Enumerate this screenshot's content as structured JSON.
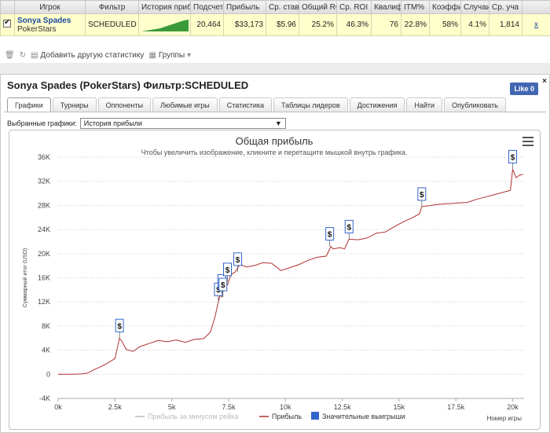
{
  "table": {
    "headers": [
      "",
      "Игрок",
      "Фильтр",
      "История прибыл",
      "Подсчет",
      "Прибыль",
      "Ср. ставк",
      "Общий ROI",
      "Ср. ROI",
      "Квалиф",
      "ITM%",
      "Коэффи",
      "Случаи",
      "Ср. уча",
      ""
    ],
    "row": {
      "player_name": "Sonya Spades",
      "player_site": "PokerStars",
      "filter": "SCHEDULED",
      "count": "20,464",
      "profit": "$33,173",
      "avg_stake": "$5.96",
      "total_roi": "25.2%",
      "avg_roi": "46.3%",
      "qualif": "76",
      "itm": "22.8%",
      "coeff": "58%",
      "cases": "4.1%",
      "avg_field": "1,814",
      "extra": "x"
    }
  },
  "toolbar": {
    "add_stat_label": "Добавить другую статистику",
    "groups_label": "Группы"
  },
  "panel": {
    "title": "Sonya Spades (PokerStars) Фильтр:SCHEDULED",
    "like_label": "Like 0",
    "close_label": "×",
    "tabs": [
      "Графики",
      "Турниры",
      "Оппоненты",
      "Любимые игры",
      "Статистика",
      "Таблицы лидеров",
      "Достижения",
      "Найти",
      "Опубликовать"
    ],
    "active_tab": 0,
    "selector_label": "Выбранные графики:",
    "selector_value": "История прибыли"
  },
  "colors": {
    "profit_line": "#b03030",
    "rake_line": "#bbbbbb",
    "big_wins": "#3366cc",
    "sparkline": "#3a9a3a"
  },
  "chart_data": {
    "type": "line",
    "title": "Общая прибыль",
    "subtitle": "Чтобы увеличить изображение, кликните и перетащите мышкой внутрь графика.",
    "xlabel": "Номер игры",
    "ylabel": "Суммарный итог (USD)",
    "xlim": [
      0,
      20500
    ],
    "ylim": [
      -4000,
      36000
    ],
    "x_ticks": [
      0,
      2500,
      5000,
      7500,
      10000,
      12500,
      15000,
      17500,
      20000
    ],
    "x_tick_labels": [
      "0k",
      "2.5k",
      "5k",
      "7.5k",
      "10k",
      "12.5k",
      "15k",
      "17.5k",
      "20k"
    ],
    "y_ticks": [
      -4000,
      0,
      4000,
      8000,
      12000,
      16000,
      20000,
      24000,
      28000,
      32000,
      36000
    ],
    "y_tick_labels": [
      "-4K",
      "0",
      "4K",
      "8K",
      "12K",
      "16K",
      "20K",
      "24K",
      "28K",
      "32K",
      "36K"
    ],
    "grid": "horizontal-dotted",
    "legend_position": "bottom",
    "series": [
      {
        "name": "Прибыль за минусом рейка",
        "values": []
      },
      {
        "name": "Прибыль",
        "x": [
          0,
          600,
          1000,
          1300,
          1600,
          1900,
          2200,
          2500,
          2700,
          2800,
          3000,
          3300,
          3600,
          4000,
          4400,
          4800,
          5200,
          5600,
          6000,
          6400,
          6700,
          6900,
          7050,
          7150,
          7200,
          7250,
          7350,
          7450,
          7600,
          7800,
          8000,
          8300,
          8700,
          9000,
          9400,
          9800,
          10200,
          10600,
          11000,
          11400,
          11800,
          12000,
          12100,
          12400,
          12600,
          12800,
          13200,
          13600,
          14000,
          14400,
          14800,
          15200,
          15600,
          15900,
          16000,
          16400,
          16800,
          17200,
          17600,
          18000,
          18400,
          18800,
          19200,
          19600,
          19900,
          20000,
          20150,
          20300,
          20450
        ],
        "values": [
          0,
          0,
          50,
          200,
          800,
          1300,
          1900,
          2600,
          6000,
          5500,
          4100,
          3800,
          4600,
          5100,
          5600,
          5400,
          5700,
          5300,
          5800,
          5900,
          7000,
          9500,
          12000,
          13400,
          12800,
          13800,
          15300,
          14800,
          16500,
          17000,
          18200,
          17800,
          18100,
          18500,
          18400,
          17200,
          17700,
          18200,
          18900,
          19400,
          19600,
          21200,
          20800,
          21000,
          20800,
          22400,
          22300,
          22600,
          23400,
          23600,
          24500,
          25300,
          26000,
          26600,
          27800,
          28000,
          28200,
          28300,
          28400,
          28500,
          29000,
          29400,
          29800,
          30200,
          30500,
          34000,
          32600,
          33000,
          33173
        ]
      },
      {
        "name": "Значительные выигрыши",
        "x": [
          2700,
          7050,
          7200,
          7250,
          7450,
          7900,
          11950,
          12800,
          16000,
          20000
        ],
        "values": [
          6000,
          12000,
          13400,
          12800,
          15300,
          17000,
          21200,
          22400,
          27800,
          34000
        ],
        "marker_label": "$"
      }
    ]
  }
}
